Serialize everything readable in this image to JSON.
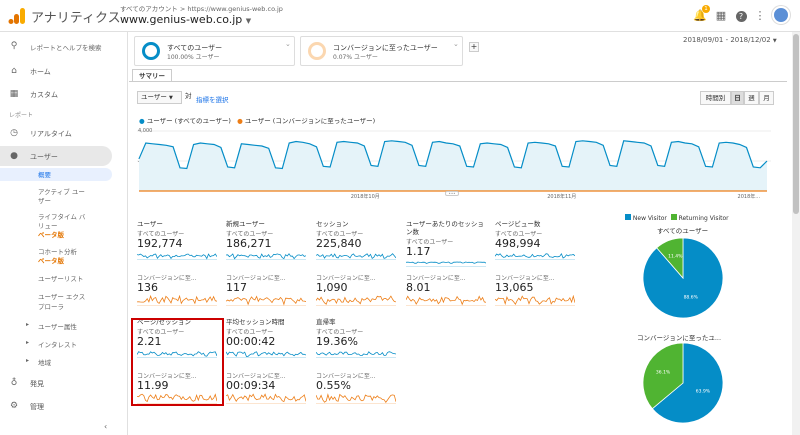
{
  "header": {
    "app_name": "アナリティクス",
    "account_path": "すべてのアカウント > https://www.genius-web.co.jp",
    "property_name": "www.genius-web.co.jp",
    "notif_count": "1"
  },
  "sidebar": {
    "search_placeholder": "レポートとヘルプを検索",
    "home": "ホーム",
    "custom": "カスタム",
    "reports_heading": "レポート",
    "realtime": "リアルタイム",
    "users": "ユーザー",
    "sub_items": [
      {
        "label": "概要"
      },
      {
        "label": "アクティブ ユー"
      },
      {
        "label": "ザー"
      },
      {
        "label": "ライフタイム バ"
      },
      {
        "label": "リュー"
      },
      {
        "label": "ベータ版"
      },
      {
        "label": "コホート分析"
      },
      {
        "label": "ベータ版"
      },
      {
        "label": "ユーザーリスト"
      },
      {
        "label": "ユーザー エクス"
      },
      {
        "label": "プローラ"
      }
    ],
    "collapsed": [
      "ユーザー属性",
      "インタレスト",
      "地域"
    ],
    "discover": "発見",
    "admin": "管理"
  },
  "segments": [
    {
      "title": "すべてのユーザー",
      "sub": "100.00% ユーザー",
      "color": "#058dc7"
    },
    {
      "title": "コンバージョンに至ったユーザー",
      "sub": "0.07% ユーザー",
      "color": "#f6b26b"
    }
  ],
  "add_segment": "+",
  "date_range": "2018/09/01 - 2018/12/02",
  "tab_summary": "サマリー",
  "controls": {
    "metric_select": "ユーザー",
    "vs": "対",
    "select_metric_link": "指標を選択",
    "time_buttons": [
      "時間別",
      "日",
      "週",
      "月"
    ]
  },
  "legend": {
    "series1": "ユーザー (すべてのユーザー)",
    "series2": "ユーザー (コンバージョンに至ったユーザー)",
    "color1": "#058dc7",
    "color2": "#ed7e17"
  },
  "chart_data": {
    "type": "area",
    "y_ticks": [
      "4,000",
      "2,000"
    ],
    "x_ticks": [
      "2018年10月",
      "2018年11月",
      "2018年..."
    ],
    "ylim": [
      0,
      4000
    ],
    "series": [
      {
        "name": "ユーザー (すべてのユーザー)",
        "values": [
          2150,
          3200,
          3150,
          3100,
          3050,
          2950,
          1550,
          1500,
          3100,
          3200,
          3150,
          3100,
          2900,
          1600,
          1550,
          3150,
          3100,
          3050,
          3000,
          2850,
          1550,
          1500,
          3200,
          3300,
          3250,
          3150,
          2950,
          1650,
          1600,
          3250,
          3300,
          3250,
          3200,
          3000,
          1700,
          1650,
          3300,
          3350,
          3300,
          3250,
          3050,
          1700,
          1650,
          3250,
          3300,
          3200,
          3150,
          3000,
          1650,
          1600,
          3150,
          3200,
          3150,
          3100,
          2900,
          1600,
          1550,
          3200,
          3250,
          3200,
          3150,
          3000,
          1650,
          1600,
          3300,
          3350,
          3300,
          3250,
          3050,
          1700,
          1650,
          3350,
          3300,
          3250,
          3200,
          3000,
          1700,
          1650,
          3250,
          3300,
          3200,
          3150,
          2950,
          1650,
          1600,
          3200,
          3250,
          3200,
          3100,
          2900,
          1600,
          1550,
          2000
        ]
      },
      {
        "name": "ユーザー (コンバージョンに至ったユーザー)",
        "values": [
          0,
          2,
          1,
          2,
          3,
          1,
          0,
          0,
          2,
          1,
          2,
          1,
          2,
          0,
          0,
          1,
          2,
          3,
          1,
          2,
          0,
          0,
          2,
          1,
          2,
          2,
          1,
          0,
          0,
          2,
          1,
          3,
          2,
          1,
          0,
          0,
          2,
          2,
          1,
          2,
          1,
          0,
          0,
          1,
          2,
          1,
          2,
          1,
          0,
          0,
          2,
          1,
          2,
          1,
          2,
          0,
          0,
          1,
          2,
          1,
          2,
          1,
          0,
          0,
          2,
          2,
          1,
          2,
          1,
          0,
          0,
          2,
          1,
          2,
          2,
          1,
          0,
          0,
          1,
          2,
          1,
          2,
          1,
          0,
          0,
          2,
          1,
          2,
          1,
          2,
          0,
          0,
          1
        ]
      }
    ]
  },
  "metrics": [
    {
      "name": "ユーザー",
      "seg1": "すべてのユーザー",
      "val1": "192,774",
      "seg2": "コンバージョンに至...",
      "val2": "136"
    },
    {
      "name": "新規ユーザー",
      "seg1": "すべてのユーザー",
      "val1": "186,271",
      "seg2": "コンバージョンに至...",
      "val2": "117"
    },
    {
      "name": "セッション",
      "seg1": "すべてのユーザー",
      "val1": "225,840",
      "seg2": "コンバージョンに至...",
      "val2": "1,090"
    },
    {
      "name": "ユーザーあたりのセッション数",
      "seg1": "すべてのユーザー",
      "val1": "1.17",
      "seg2": "コンバージョンに至...",
      "val2": "8.01"
    },
    {
      "name": "ページビュー数",
      "seg1": "すべてのユーザー",
      "val1": "498,994",
      "seg2": "コンバージョンに至...",
      "val2": "13,065"
    },
    {
      "name": "ページ/セッション",
      "seg1": "すべてのユーザー",
      "val1": "2.21",
      "seg2": "コンバージョンに至...",
      "val2": "11.99"
    },
    {
      "name": "平均セッション時間",
      "seg1": "すべてのユーザー",
      "val1": "00:00:42",
      "seg2": "コンバージョンに至...",
      "val2": "00:09:34"
    },
    {
      "name": "直帰率",
      "seg1": "すべてのユーザー",
      "val1": "19.36%",
      "seg2": "コンバージョンに至...",
      "val2": "0.55%"
    }
  ],
  "pie_legend": {
    "new": "New Visitor",
    "returning": "Returning Visitor",
    "new_color": "#058dc7",
    "returning_color": "#50b432"
  },
  "pies": [
    {
      "title": "すべてのユーザー",
      "new_pct": 88.6,
      "returning_pct": 11.4,
      "new_label": "88.6%",
      "returning_label": "11.4%"
    },
    {
      "title": "コンバージョンに至ったユ...",
      "new_pct": 63.9,
      "returning_pct": 36.1,
      "new_label": "63.9%",
      "returning_label": "36.1%"
    }
  ]
}
